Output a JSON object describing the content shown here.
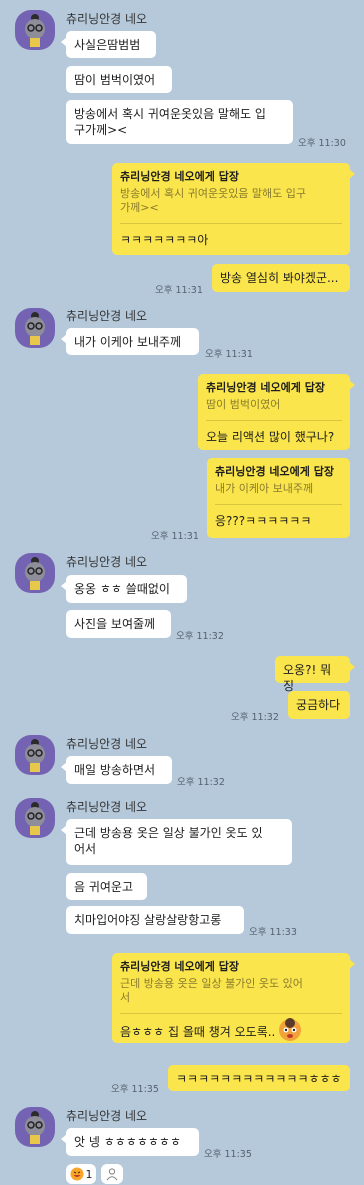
{
  "sender": "츄리닝안경 네오",
  "messages": [
    {
      "text": "사실은땀범범"
    },
    {
      "text": "땀이 범벅이였어"
    },
    {
      "text": "방송에서 혹시 귀여운옷있음 말해도 입구가께>< ",
      "line1": "방송에서 혹시 귀여운옷있음 말해도 입",
      "line2": "구가께><",
      "time": "오후 11:30"
    },
    {
      "reply_head": "츄리닝안경 네오에게 답장",
      "quote1": "방송에서 혹시 귀여운옷있음 말해도 입구",
      "quote2": "가께><",
      "text": "ㅋㅋㅋㅋㅋㅋㅋ아"
    },
    {
      "text": "방송 열심히 봐야겠군...",
      "time": "오후 11:31"
    },
    {
      "text": "내가 이케아 보내주께",
      "time": "오후 11:31"
    },
    {
      "reply_head": "츄리닝안경 네오에게 답장",
      "quote": "땀이 범벅이였어",
      "text": "오늘 리액션 많이 했구나?"
    },
    {
      "reply_head": "츄리닝안경 네오에게 답장",
      "quote": "내가 이케아 보내주께",
      "text": "응???ㅋㅋㅋㅋㅋㅋ",
      "time": "오후 11:31"
    },
    {
      "text": "옹옹 ㅎㅎ 쓸때없이"
    },
    {
      "text": "사진을 보여줄께",
      "time": "오후 11:32"
    },
    {
      "text": "오옹?! 뭐징"
    },
    {
      "text": "궁금하다",
      "time": "오후 11:32"
    },
    {
      "text": "매일 방송하면서",
      "time": "오후 11:32"
    },
    {
      "line1": "근데 방송용 옷은 일상 불가인 옷도 있",
      "line2": "어서"
    },
    {
      "text": "음 귀여운고"
    },
    {
      "text": "치마입어야징 살랑살랑항고롱",
      "time": "오후 11:33"
    },
    {
      "reply_head": "츄리닝안경 네오에게 답장",
      "quote1": "근데 방송용 옷은 일상 불가인 옷도 있어",
      "quote2": "서",
      "text": "음ㅎㅎㅎ 집 올때 챙겨 오도록.."
    },
    {
      "text": "ㅋㅋㅋㅋㅋㅋㅋㅋㅋㅋㅋㅋㅎㅎㅎ",
      "time": "오후 11:35"
    },
    {
      "text": "앗 넹 ㅎㅎㅎㅎㅎㅎㅎ",
      "time": "오후 11:35"
    }
  ],
  "reaction": {
    "count": "1"
  },
  "colors": {
    "background": "#b6c9da",
    "mine": "#fae54c",
    "theirs": "#ffffff",
    "avatar": "#7463b3"
  }
}
